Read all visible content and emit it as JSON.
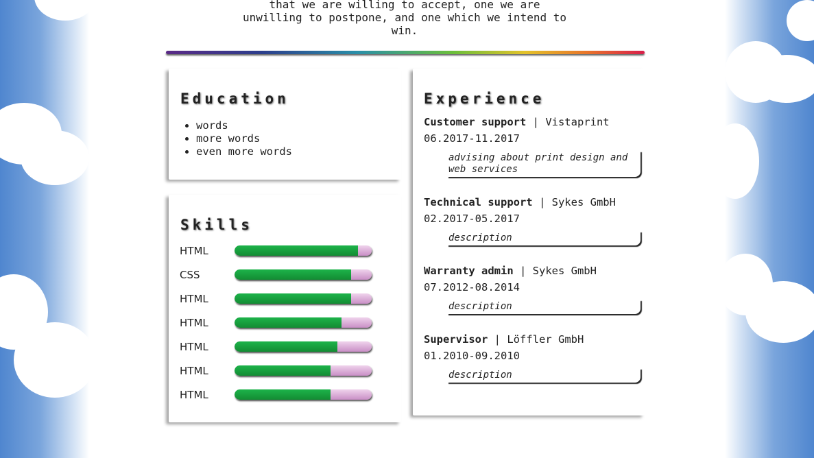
{
  "quote": {
    "line1": "that we are willing to accept, one we are",
    "line2": "unwilling to postpone, and one which we intend to",
    "line3": "win."
  },
  "education": {
    "title": "Education",
    "items": [
      "words",
      "more words",
      "even more words"
    ]
  },
  "skills": {
    "title": "Skills",
    "items": [
      {
        "label": "HTML",
        "level": 0.9
      },
      {
        "label": "CSS",
        "level": 0.85
      },
      {
        "label": "HTML",
        "level": 0.85
      },
      {
        "label": "HTML",
        "level": 0.78
      },
      {
        "label": "HTML",
        "level": 0.75
      },
      {
        "label": "HTML",
        "level": 0.7
      },
      {
        "label": "HTML",
        "level": 0.7
      }
    ]
  },
  "experience": {
    "title": "Experience",
    "jobs": [
      {
        "role": "Customer support",
        "company": "Vistaprint",
        "dates": "06.2017-11.2017",
        "description": "advising about print design and web services"
      },
      {
        "role": "Technical support",
        "company": "Sykes GmbH",
        "dates": "02.2017-05.2017",
        "description": "description"
      },
      {
        "role": "Warranty admin",
        "company": "Sykes GmbH",
        "dates": "07.2012-08.2014",
        "description": "description"
      },
      {
        "role": "Supervisor",
        "company": "Löffler GmbH",
        "dates": "01.2010-09.2010",
        "description": "description"
      }
    ]
  },
  "colors": {
    "skill_fill": "#1db34a",
    "skill_track": "#d9a6d6",
    "sky": "#4f86cf"
  }
}
